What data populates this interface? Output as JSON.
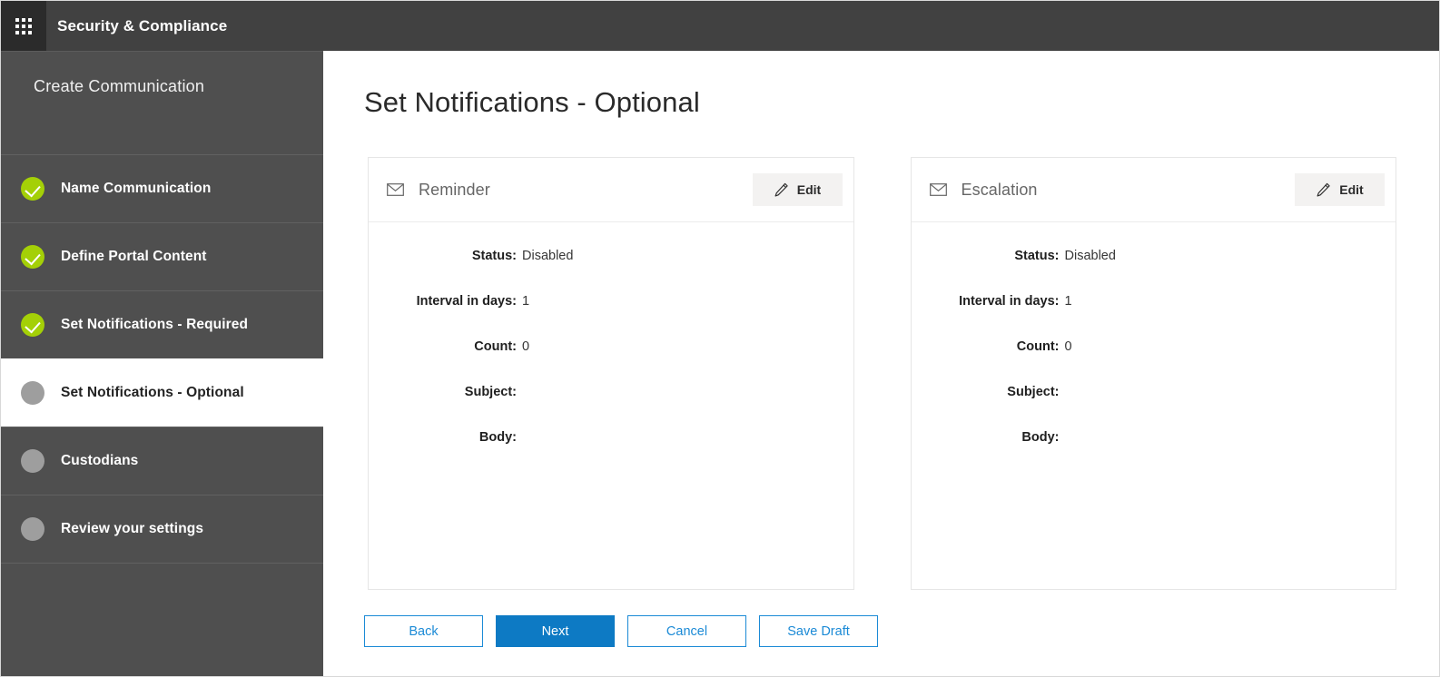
{
  "topbar": {
    "waffle_icon": "app-launcher-waffle-icon",
    "app_title": "Security & Compliance"
  },
  "sidebar": {
    "heading": "Create Communication",
    "items": [
      {
        "label": "Name Communication",
        "state": "done",
        "bullet_icon": "check-circle-icon"
      },
      {
        "label": "Define Portal Content",
        "state": "done",
        "bullet_icon": "check-circle-icon"
      },
      {
        "label": "Set Notifications - Required",
        "state": "done",
        "bullet_icon": "check-circle-icon"
      },
      {
        "label": "Set Notifications - Optional",
        "state": "active",
        "bullet_icon": "dot-circle-icon"
      },
      {
        "label": "Custodians",
        "state": "pending",
        "bullet_icon": "dot-circle-icon"
      },
      {
        "label": "Review your settings",
        "state": "pending",
        "bullet_icon": "dot-circle-icon"
      }
    ]
  },
  "main": {
    "page_title": "Set Notifications - Optional",
    "cards": [
      {
        "icon": "envelope-icon",
        "title": "Reminder",
        "edit_label": "Edit",
        "edit_icon": "pencil-icon",
        "fields": [
          {
            "label": "Status:",
            "value": "Disabled"
          },
          {
            "label": "Interval in days:",
            "value": "1"
          },
          {
            "label": "Count:",
            "value": "0"
          },
          {
            "label": "Subject:",
            "value": ""
          },
          {
            "label": "Body:",
            "value": ""
          }
        ]
      },
      {
        "icon": "envelope-icon",
        "title": "Escalation",
        "edit_label": "Edit",
        "edit_icon": "pencil-icon",
        "fields": [
          {
            "label": "Status:",
            "value": "Disabled"
          },
          {
            "label": "Interval in days:",
            "value": "1"
          },
          {
            "label": "Count:",
            "value": "0"
          },
          {
            "label": "Subject:",
            "value": ""
          },
          {
            "label": "Body:",
            "value": ""
          }
        ]
      }
    ],
    "footer_buttons": [
      {
        "label": "Back",
        "style": "secondary"
      },
      {
        "label": "Next",
        "style": "primary"
      },
      {
        "label": "Cancel",
        "style": "secondary"
      },
      {
        "label": "Save Draft",
        "style": "secondary"
      }
    ]
  },
  "colors": {
    "topbar_bg": "#414141",
    "sidebar_bg": "#4f4f4f",
    "waffle_bg": "#2b2b2b",
    "step_done": "#a4d007",
    "step_pending": "#9e9e9e",
    "accent_blue": "#0d7ac4",
    "link_blue": "#1b8ad6",
    "card_border": "#e6e6e6",
    "edit_btn_bg": "#f3f2f1"
  }
}
